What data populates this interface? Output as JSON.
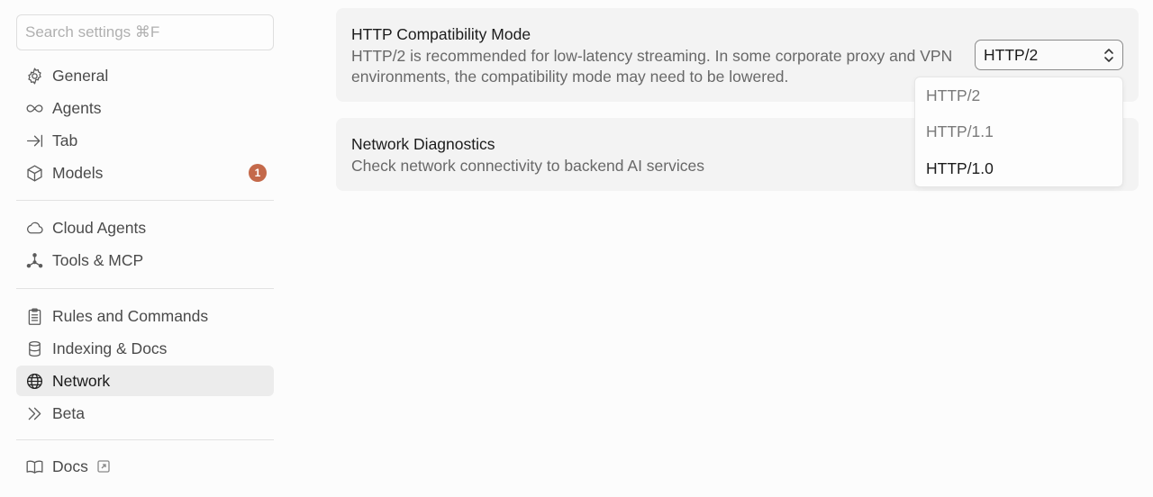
{
  "search": {
    "placeholder": "Search settings ⌘F"
  },
  "sidebar": {
    "items": [
      {
        "label": "General",
        "icon": "gear-icon"
      },
      {
        "label": "Agents",
        "icon": "infinity-icon"
      },
      {
        "label": "Tab",
        "icon": "tab-arrow-icon"
      },
      {
        "label": "Models",
        "icon": "cube-icon",
        "badge": "1"
      },
      {
        "label": "Cloud Agents",
        "icon": "cloud-icon"
      },
      {
        "label": "Tools & MCP",
        "icon": "nodes-icon"
      },
      {
        "label": "Rules and Commands",
        "icon": "clipboard-icon"
      },
      {
        "label": "Indexing & Docs",
        "icon": "database-icon"
      },
      {
        "label": "Network",
        "icon": "globe-icon",
        "active": true
      },
      {
        "label": "Beta",
        "icon": "double-chevron-icon"
      },
      {
        "label": "Docs",
        "icon": "book-icon",
        "external": true
      }
    ]
  },
  "main": {
    "http_card": {
      "title": "HTTP Compatibility Mode",
      "description": "HTTP/2 is recommended for low-latency streaming. In some corporate proxy and VPN environments, the compatibility mode may need to be lowered.",
      "select_value": "HTTP/2",
      "options": [
        "HTTP/2",
        "HTTP/1.1",
        "HTTP/1.0"
      ]
    },
    "diag_card": {
      "title": "Network Diagnostics",
      "description": "Check network connectivity to backend AI services"
    }
  },
  "colors": {
    "badge": "#c4694a",
    "active_bg": "#ececec",
    "card_bg": "#f3f3f3"
  }
}
